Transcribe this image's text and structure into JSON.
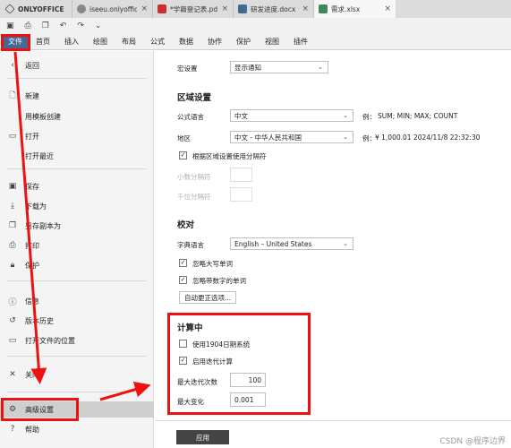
{
  "app": {
    "logo": "ONLYOFFICE"
  },
  "tabs": [
    {
      "label": "iseeu.onlyoffic",
      "icon": "globe-icon",
      "color": "#888888"
    },
    {
      "label": "*学籍登记表.pdf",
      "icon": "pdf-icon",
      "color": "#c9302c"
    },
    {
      "label": "研发进度.docx",
      "icon": "docx-icon",
      "color": "#446995"
    },
    {
      "label": "需求.xlsx",
      "icon": "xlsx-icon",
      "color": "#40865c",
      "active": true
    }
  ],
  "quick_toolbar": [
    "save-icon",
    "print-icon",
    "copy-icon",
    "undo-icon",
    "redo-icon",
    "dropdown-icon"
  ],
  "menu": [
    "文件",
    "首页",
    "插入",
    "绘图",
    "布局",
    "公式",
    "数据",
    "协作",
    "保护",
    "视图",
    "插件"
  ],
  "left_menu": {
    "back": "返回",
    "new": "新建",
    "from_template": "用模板创建",
    "open": "打开",
    "recent": "打开最近",
    "save": "保存",
    "download": "下载为",
    "save_copy": "另存副本为",
    "print": "打印",
    "protect": "保护",
    "info": "信息",
    "history": "版本历史",
    "file_location": "打开文件的位置",
    "close": "关闭",
    "advanced": "高级设置",
    "help": "帮助"
  },
  "settings": {
    "macro": {
      "label": "宏设置",
      "value": "显示通知"
    },
    "region_heading": "区域设置",
    "formula_lang": {
      "label": "公式语言",
      "value": "中文",
      "example_label": "例：",
      "example": "SUM; MIN; MAX; COUNT"
    },
    "region": {
      "label": "地区",
      "value": "中文 - 中华人民共和国",
      "example_label": "例：",
      "example": "¥ 1,000.01 2024/11/8 22:32:30"
    },
    "use_region_separators": {
      "label": "根据区域设置使用分隔符",
      "checked": true
    },
    "decimal_sep": {
      "label": "小数分隔符",
      "value": ""
    },
    "thousand_sep": {
      "label": "千位分隔符",
      "value": ""
    },
    "proof_heading": "校对",
    "dictionary": {
      "label": "字典语言",
      "value": "English – United States"
    },
    "ignore_upper": {
      "label": "忽略大写单词",
      "checked": true
    },
    "ignore_numbers": {
      "label": "忽略带数字的单词",
      "checked": true
    },
    "autocorrect_button": "自动更正选项...",
    "calc_heading": "计算中",
    "use_1904": {
      "label": "使用1904日期系统",
      "checked": false
    },
    "iterative": {
      "label": "启用迭代计算",
      "checked": true
    },
    "max_iterations": {
      "label": "最大迭代次数",
      "value": "100"
    },
    "max_change": {
      "label": "最大变化",
      "value": "0.001"
    },
    "apply_button": "应用"
  },
  "watermark": "CSDN @程序边界",
  "colors": {
    "accent": "#446995",
    "annotation": "#ee1111",
    "selected": "#cfcfcf"
  }
}
